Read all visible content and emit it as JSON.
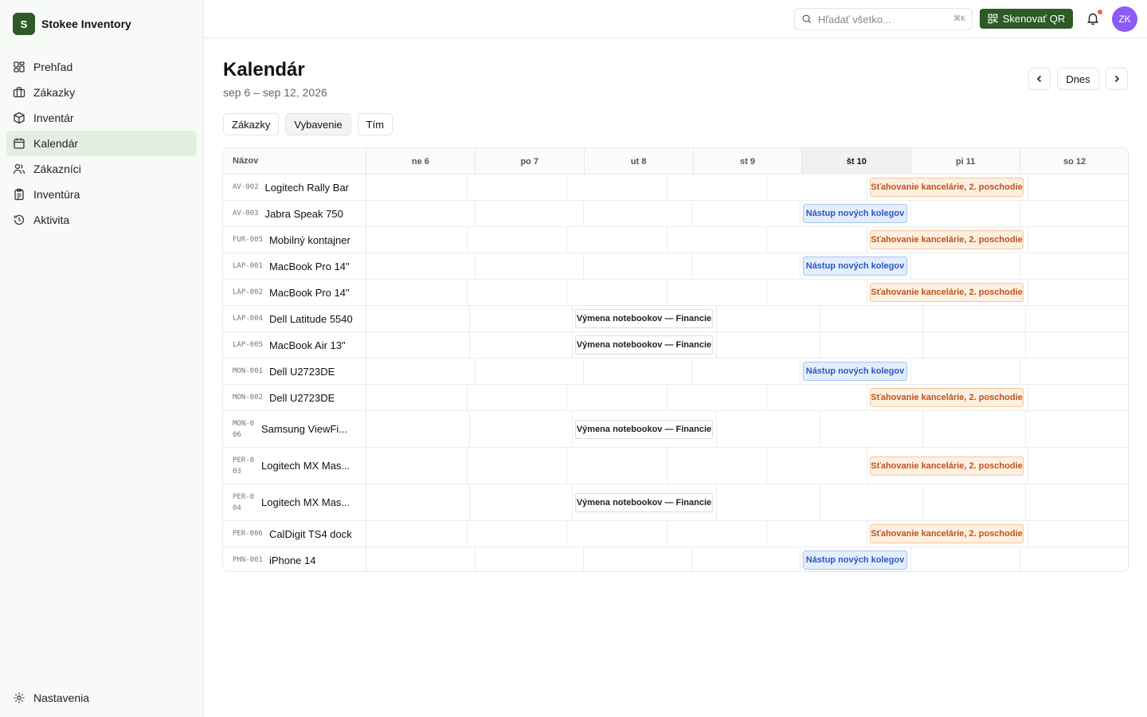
{
  "app": {
    "logo_letter": "S",
    "name": "Stokee Inventory"
  },
  "sidebar": {
    "items": [
      {
        "label": "Prehľad",
        "icon": "dashboard-icon"
      },
      {
        "label": "Zákazky",
        "icon": "briefcase-icon"
      },
      {
        "label": "Inventár",
        "icon": "box-icon"
      },
      {
        "label": "Kalendár",
        "icon": "calendar-icon",
        "active": true
      },
      {
        "label": "Zákazníci",
        "icon": "users-icon"
      },
      {
        "label": "Inventúra",
        "icon": "clipboard-icon"
      },
      {
        "label": "Aktivita",
        "icon": "history-icon"
      }
    ],
    "settings_label": "Nastavenia"
  },
  "topbar": {
    "search_placeholder": "Hľadať všetko...",
    "search_shortcut": "⌘K",
    "scan_label": "Skenovať QR",
    "avatar_initials": "ZK",
    "notification_dot_color": "#e8692b"
  },
  "page": {
    "title": "Kalendár",
    "range": "sep 6 – sep 12, 2026",
    "today_label": "Dnes"
  },
  "filters": [
    {
      "label": "Zákazky",
      "active": false
    },
    {
      "label": "Vybavenie",
      "active": true
    },
    {
      "label": "Tím",
      "active": false
    }
  ],
  "grid": {
    "name_header": "Názov",
    "days": [
      {
        "label": "ne 6",
        "today": false
      },
      {
        "label": "po 7",
        "today": false
      },
      {
        "label": "ut 8",
        "today": false
      },
      {
        "label": "st 9",
        "today": false
      },
      {
        "label": "št 10",
        "today": true
      },
      {
        "label": "pi 11",
        "today": false
      },
      {
        "label": "so 12",
        "today": false
      }
    ],
    "rows": [
      {
        "sku": "AV-002",
        "name": "Logitech Rally Bar",
        "event": "Sťahovanie kancelárie, 2. poschodie",
        "kind": "orange"
      },
      {
        "sku": "AV-003",
        "name": "Jabra Speak 750",
        "event": "Nástup nových kolegov",
        "kind": "blue"
      },
      {
        "sku": "FUR-005",
        "name": "Mobilný kontajner",
        "event": "Sťahovanie kancelárie, 2. poschodie",
        "kind": "orange"
      },
      {
        "sku": "LAP-001",
        "name": "MacBook Pro 14\"",
        "event": "Nástup nových kolegov",
        "kind": "blue"
      },
      {
        "sku": "LAP-002",
        "name": "MacBook Pro 14\"",
        "event": "Sťahovanie kancelárie, 2. poschodie",
        "kind": "orange"
      },
      {
        "sku": "LAP-004",
        "name": "Dell Latitude 5540",
        "event": "Výmena notebookov — Financie",
        "kind": "white"
      },
      {
        "sku": "LAP-005",
        "name": "MacBook Air 13\"",
        "event": "Výmena notebookov — Financie",
        "kind": "white"
      },
      {
        "sku": "MON-001",
        "name": "Dell U2723DE",
        "event": "Nástup nových kolegov",
        "kind": "blue"
      },
      {
        "sku": "MON-002",
        "name": "Dell U2723DE",
        "event": "Sťahovanie kancelárie, 2. poschodie",
        "kind": "orange"
      },
      {
        "sku": "MON-006",
        "name": "Samsung ViewFi...",
        "event": "Výmena notebookov — Financie",
        "kind": "white",
        "tall": true
      },
      {
        "sku": "PER-003",
        "name": "Logitech MX Mas...",
        "event": "Sťahovanie kancelárie, 2. poschodie",
        "kind": "orange",
        "tall": true
      },
      {
        "sku": "PER-004",
        "name": "Logitech MX Mas...",
        "event": "Výmena notebookov — Financie",
        "kind": "white",
        "tall": true
      },
      {
        "sku": "PER-006",
        "name": "CalDigit TS4 dock",
        "event": "Sťahovanie kancelárie, 2. poschodie",
        "kind": "orange"
      },
      {
        "sku": "PHN-001",
        "name": "iPhone 14",
        "event": "Nástup nových kolegov",
        "kind": "blue"
      }
    ]
  }
}
